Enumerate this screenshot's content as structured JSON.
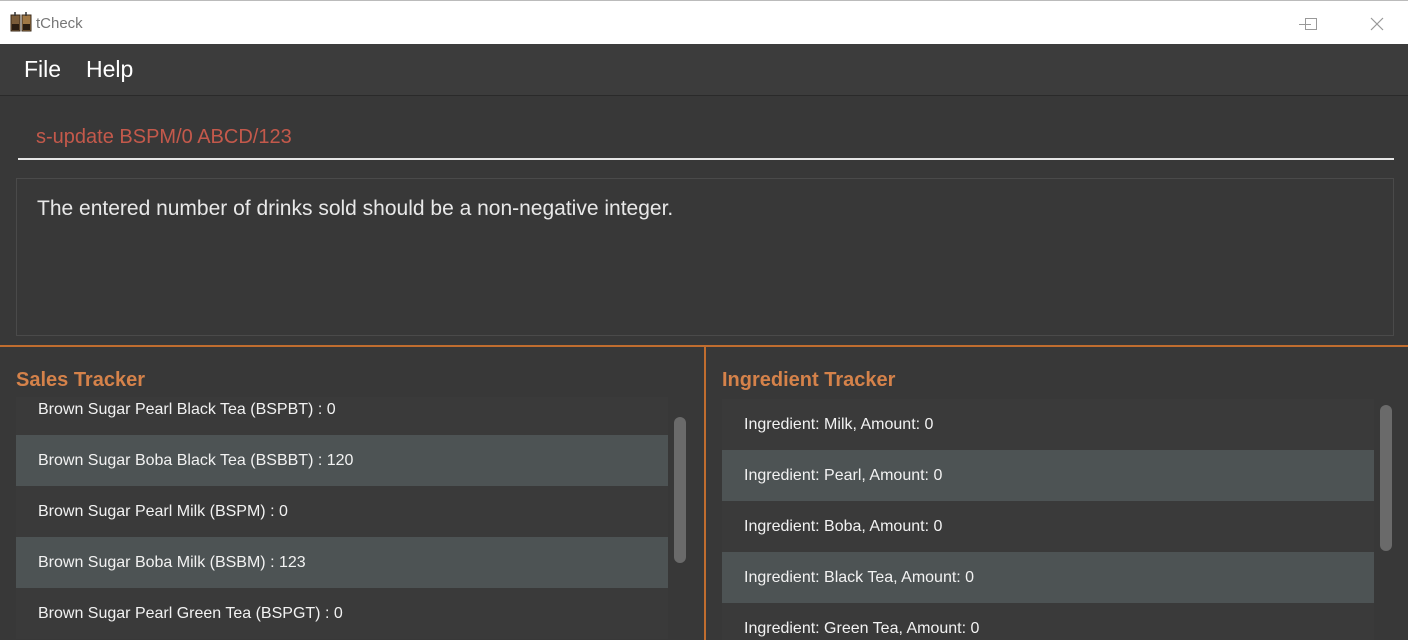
{
  "window": {
    "title": "tCheck",
    "icon": "bubble-tea-icon"
  },
  "menu": {
    "items": [
      {
        "label": "File"
      },
      {
        "label": "Help"
      }
    ]
  },
  "command": {
    "value": "s-update BSPM/0 ABCD/123"
  },
  "result": {
    "message": "The entered number of drinks sold should be a non-negative integer."
  },
  "sales": {
    "title": "Sales Tracker",
    "items": [
      "Brown Sugar Pearl Black Tea (BSPBT) : 0",
      "Brown Sugar Boba Black Tea (BSBBT) : 120",
      "Brown Sugar Pearl Milk (BSPM) : 0",
      "Brown Sugar Boba Milk (BSBM) : 123",
      "Brown Sugar Pearl Green Tea (BSPGT) : 0"
    ]
  },
  "ingredients": {
    "title": "Ingredient Tracker",
    "items": [
      "Ingredient: Milk,  Amount: 0",
      "Ingredient: Pearl,  Amount: 0",
      "Ingredient: Boba,  Amount: 0",
      "Ingredient: Black Tea,  Amount: 0",
      "Ingredient: Green Tea,  Amount: 0"
    ]
  },
  "colors": {
    "accent": "#c06d2f",
    "panel_title": "#d5824a",
    "command_text": "#c4594b",
    "row_alt": "#4d5354"
  }
}
